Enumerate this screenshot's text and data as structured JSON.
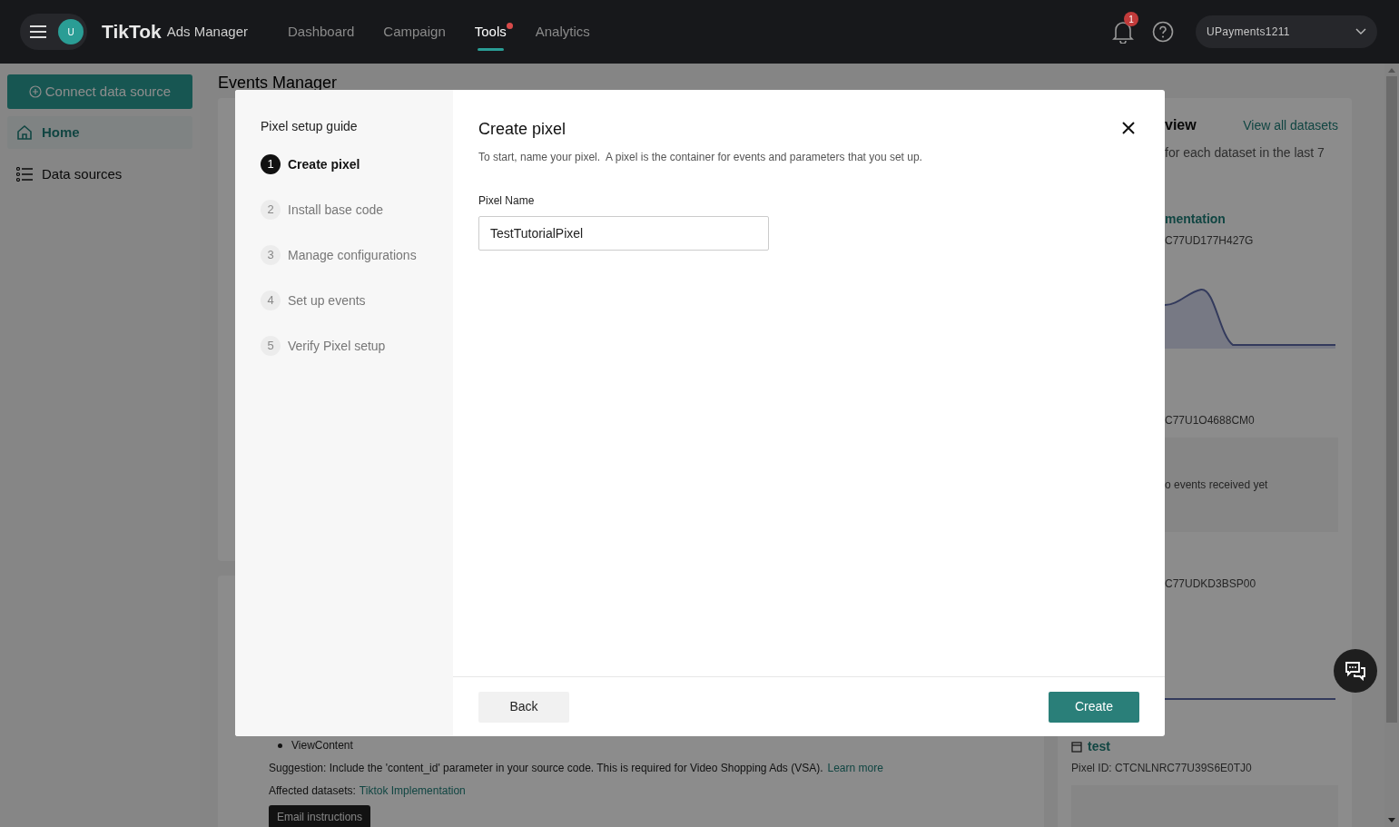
{
  "top_bar": {
    "logo": "TikTok",
    "logo_suffix": "Ads Manager",
    "avatar": "U",
    "notification_count": "1",
    "account": "UPayments1211",
    "nav": [
      {
        "label": "Dashboard",
        "selected": false,
        "dot": false
      },
      {
        "label": "Campaign",
        "selected": false,
        "dot": false
      },
      {
        "label": "Tools",
        "selected": true,
        "dot": true
      },
      {
        "label": "Analytics",
        "selected": false,
        "dot": false
      }
    ]
  },
  "sidebar": {
    "connect_button": "Connect data source",
    "items": [
      {
        "label": "Home",
        "selected": true,
        "kind": "home"
      },
      {
        "label": "Data sources",
        "selected": false,
        "kind": "list"
      }
    ]
  },
  "page_title": "Events Manager",
  "issue": {
    "bullet": "ViewContent",
    "suggestion": "Suggestion: Include the 'content_id' parameter in your source code. This is required for Video Shopping Ads (VSA).",
    "learn_more": "Learn more",
    "affected_label": "Affected datasets:",
    "affected_link": "Tiktok Implementation",
    "email_button": "Email instructions"
  },
  "overview": {
    "title": "view",
    "link": "View all datasets",
    "subtitle": "for each dataset in the last 7",
    "datasets": [
      {
        "kind": "chart",
        "name": "mentation",
        "id": "C77UD177H427G"
      },
      {
        "kind": "empty",
        "id": "C77U1O4688CM0",
        "note": "o events received yet"
      },
      {
        "kind": "flat",
        "id": "C77UDKD3BSP00"
      },
      {
        "kind": "full",
        "name": "test",
        "id": "Pixel ID: CTCNLNRC77U39S6E0TJ0"
      }
    ]
  },
  "modal": {
    "guide_title": "Pixel setup guide",
    "steps": [
      {
        "number": "1",
        "label": "Create pixel",
        "selected": true
      },
      {
        "number": "2",
        "label": "Install base code",
        "selected": false
      },
      {
        "number": "3",
        "label": "Manage configurations",
        "selected": false
      },
      {
        "number": "4",
        "label": "Set up events",
        "selected": false
      },
      {
        "number": "5",
        "label": "Verify Pixel setup",
        "selected": false
      }
    ],
    "title": "Create pixel",
    "description": "To start, name your pixel.  A pixel is the container for events and parameters that you set up.",
    "field_label": "Pixel Name",
    "field_value": "TestTutorialPixel",
    "back_button": "Back",
    "create_button": "Create"
  }
}
